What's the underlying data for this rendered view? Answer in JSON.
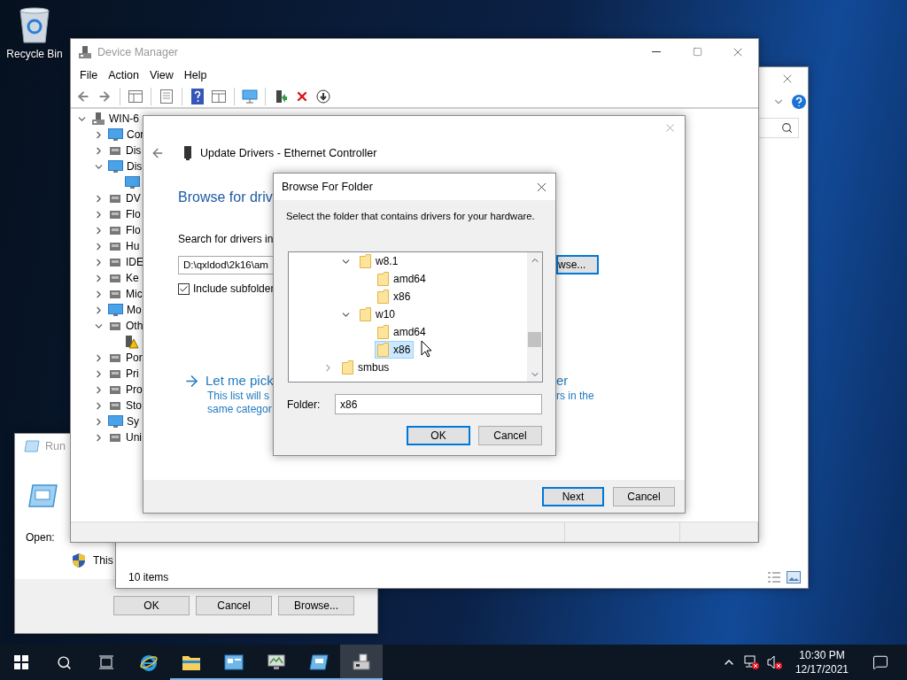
{
  "desktop": {
    "icons": [
      {
        "label": "Recycle Bin"
      }
    ]
  },
  "run_dialog": {
    "title": "Run",
    "open_label": "Open:",
    "note": "This",
    "buttons": [
      "OK",
      "Cancel",
      "Browse..."
    ]
  },
  "explorer_window": {
    "status": "10 items"
  },
  "device_manager": {
    "title": "Device Manager",
    "menu": [
      "File",
      "Action",
      "View",
      "Help"
    ],
    "tree": [
      {
        "label": "WIN-6",
        "kind": "computer",
        "expanded": true,
        "children": [
          {
            "label": "Cor",
            "kind": "monitor",
            "expanded": false
          },
          {
            "label": "Dis",
            "kind": "device",
            "expanded": false
          },
          {
            "label": "Dis",
            "kind": "monitor",
            "expanded": true,
            "children": [
              {
                "kind": "monitor"
              }
            ]
          },
          {
            "label": "DV",
            "kind": "device",
            "expanded": false
          },
          {
            "label": "Flo",
            "kind": "device",
            "expanded": false
          },
          {
            "label": "Flo",
            "kind": "device",
            "expanded": false
          },
          {
            "label": "Hu",
            "kind": "device",
            "expanded": false
          },
          {
            "label": "IDE",
            "kind": "device",
            "expanded": false
          },
          {
            "label": "Ke",
            "kind": "device",
            "expanded": false
          },
          {
            "label": "Mic",
            "kind": "device",
            "expanded": false
          },
          {
            "label": "Mo",
            "kind": "monitor",
            "expanded": false
          },
          {
            "label": "Oth",
            "kind": "device",
            "expanded": true,
            "children": [
              {
                "kind": "warning"
              }
            ]
          },
          {
            "label": "Por",
            "kind": "device",
            "expanded": false
          },
          {
            "label": "Pri",
            "kind": "device",
            "expanded": false
          },
          {
            "label": "Pro",
            "kind": "device",
            "expanded": false
          },
          {
            "label": "Sto",
            "kind": "device",
            "expanded": false
          },
          {
            "label": "Sy",
            "kind": "monitor",
            "expanded": false
          },
          {
            "label": "Uni",
            "kind": "device",
            "expanded": false
          }
        ]
      }
    ]
  },
  "update_drivers": {
    "title": "Update Drivers - Ethernet Controller",
    "heading": "Browse for driv",
    "search_label": "Search for drivers in",
    "path": "D:\\qxldod\\2k16\\am",
    "browse_button": "wse...",
    "include_subfolders": {
      "label": "Include subfolder",
      "checked": true
    },
    "pick_link": "Let me pick",
    "pick_link_end": "er",
    "pick_text": "This list will s",
    "pick_text_end": "rs in the",
    "pick_text_2": "same categor",
    "buttons": [
      "Next",
      "Cancel"
    ]
  },
  "browse_dialog": {
    "title": "Browse For Folder",
    "instruction": "Select the folder that contains drivers for your hardware.",
    "folder_tree": [
      {
        "children": [
          {
            "label": "w8.1",
            "selected": false,
            "expanded": true,
            "children": [
              {
                "label": "amd64",
                "selected": false
              },
              {
                "label": "x86",
                "selected": false
              }
            ]
          },
          {
            "label": "w10",
            "selected": false,
            "expanded": true,
            "children": [
              {
                "label": "amd64",
                "selected": false
              },
              {
                "label": "x86",
                "selected": true
              }
            ]
          }
        ]
      },
      {
        "label": "smbus",
        "selected": false,
        "expanded": false
      }
    ],
    "folder_label": "Folder:",
    "folder_value": "x86",
    "buttons": [
      "OK",
      "Cancel"
    ]
  },
  "taskbar": {
    "apps": [
      {
        "kind": "browser",
        "running": false,
        "selected": false
      },
      {
        "kind": "folder",
        "running": true,
        "selected": false
      },
      {
        "kind": "panel",
        "running": true,
        "selected": false
      },
      {
        "kind": "monitor",
        "running": true,
        "selected": false
      },
      {
        "kind": "run",
        "running": true,
        "selected": false
      },
      {
        "kind": "devices",
        "running": true,
        "selected": true
      }
    ],
    "time": "10:30 PM",
    "date": "12/17/2021"
  }
}
